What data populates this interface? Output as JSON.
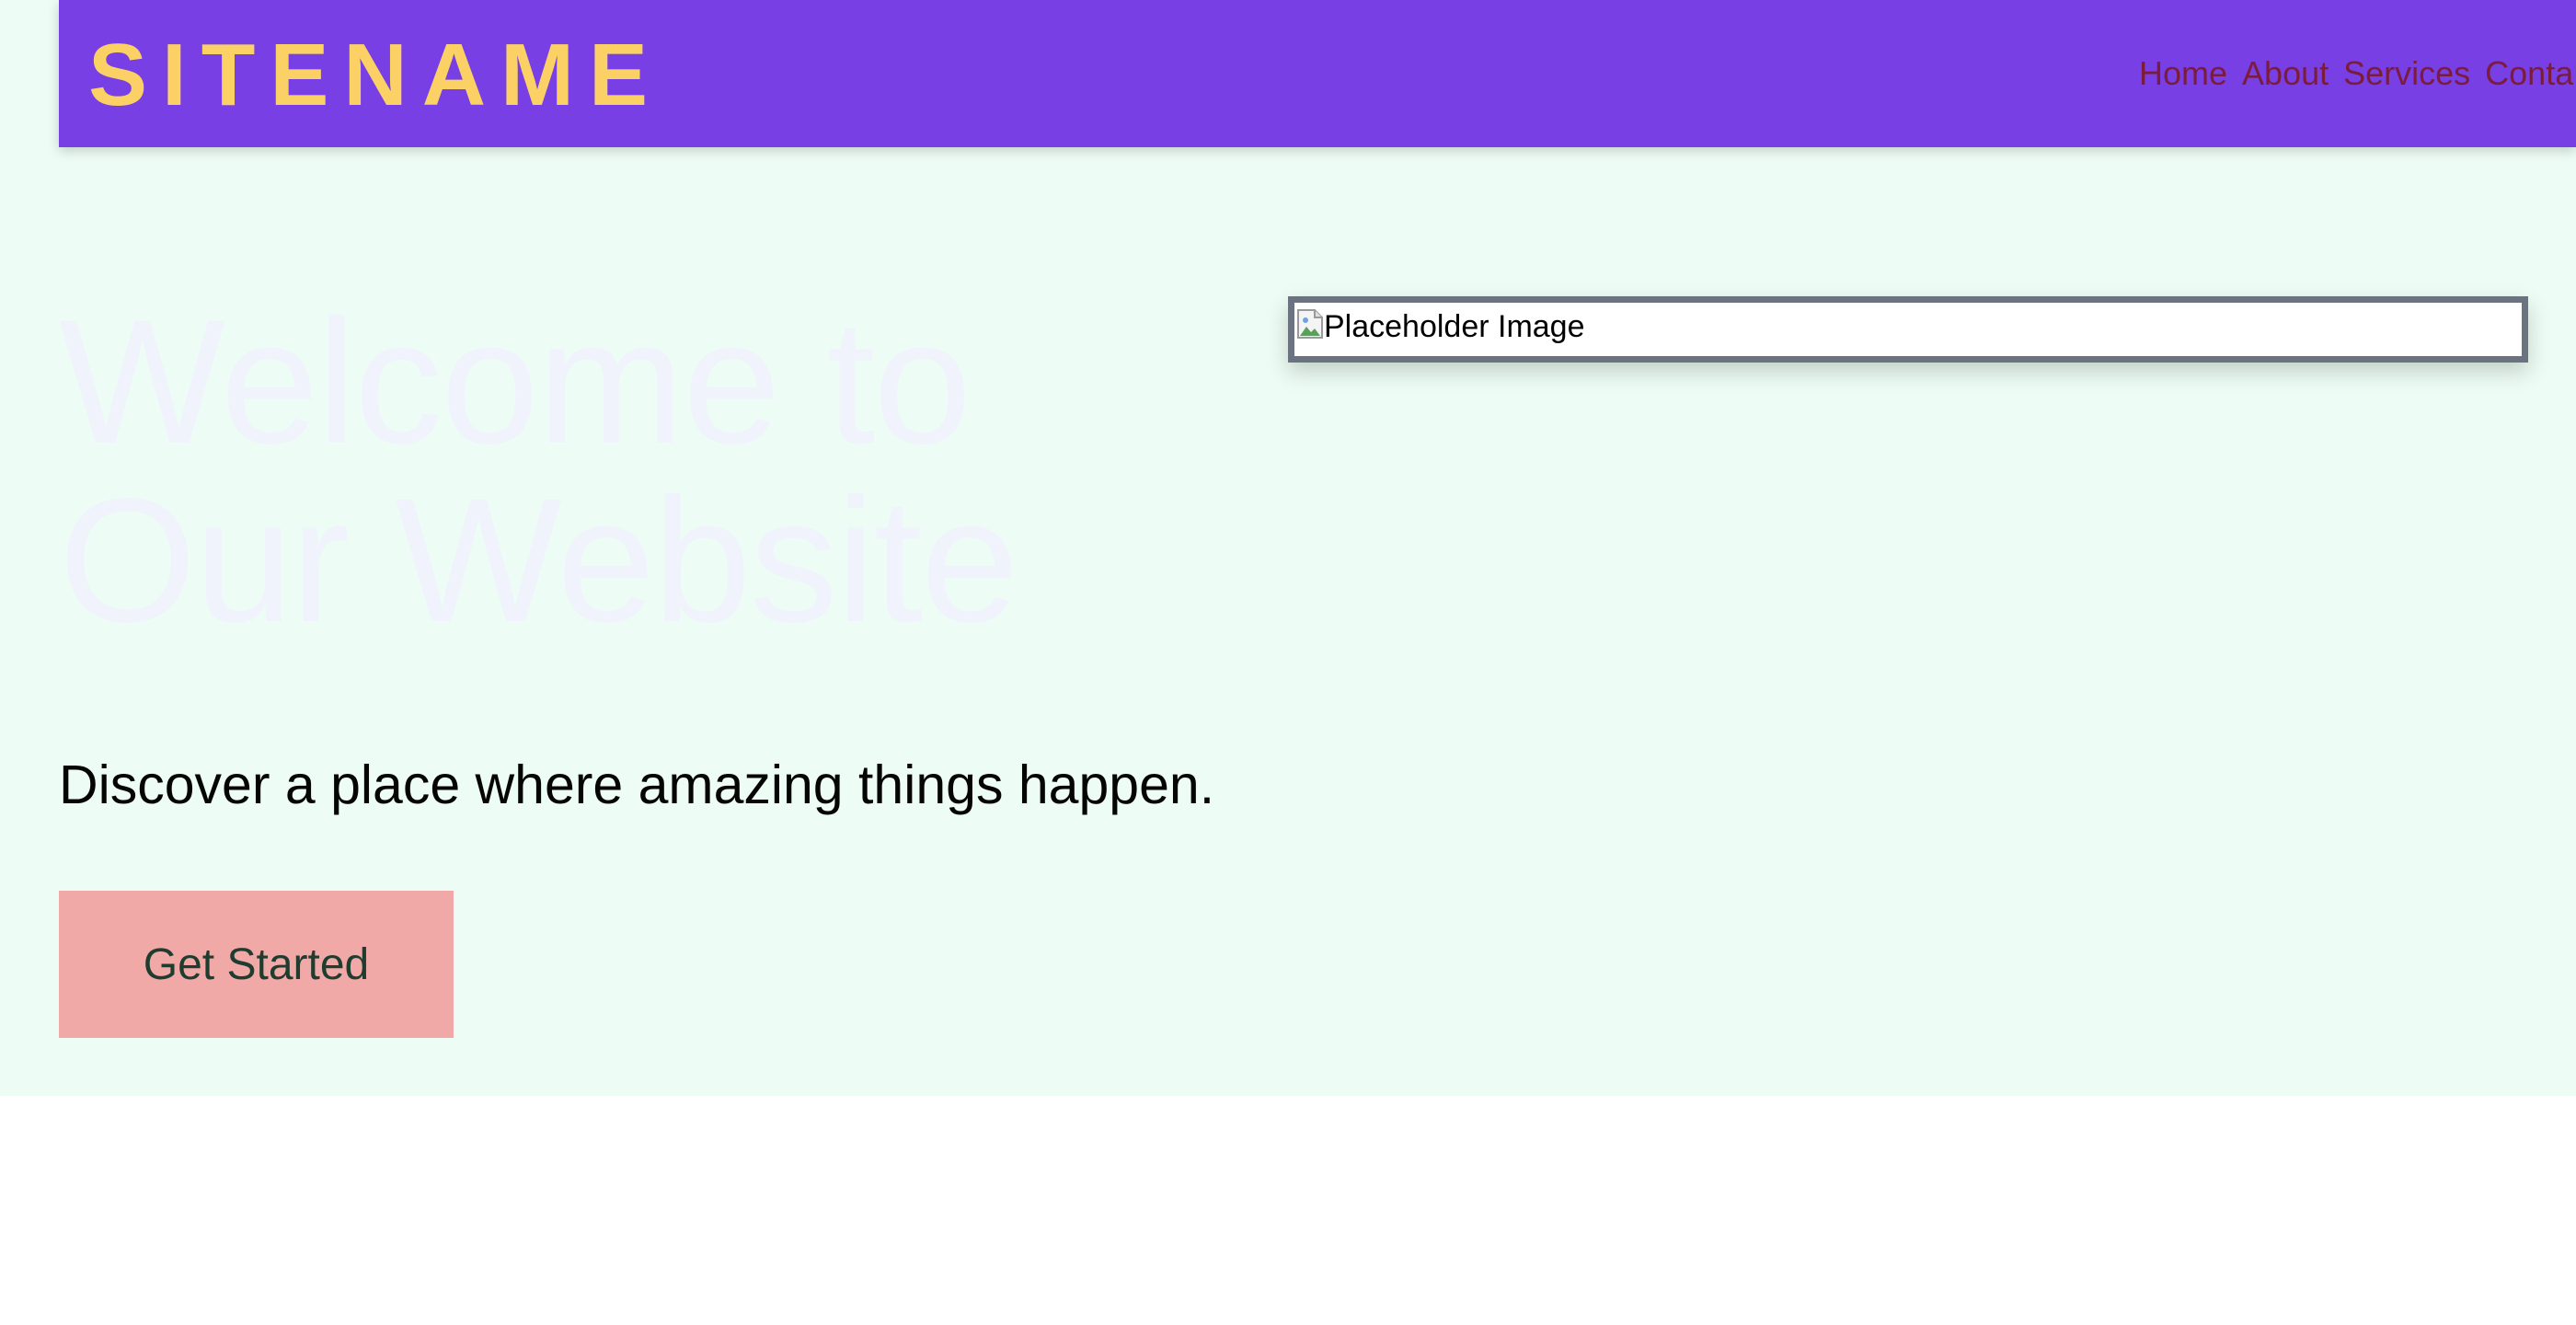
{
  "header": {
    "logo": "SITENAME",
    "nav": [
      "Home",
      "About",
      "Services",
      "Conta"
    ]
  },
  "hero": {
    "title": "Welcome to Our Website",
    "subtitle": "Discover a place where amazing things happen.",
    "cta_label": "Get Started",
    "image_alt": "Placeholder Image"
  },
  "icons": {
    "broken_image": "broken-image-icon"
  },
  "colors": {
    "header_bg": "#773fe4",
    "logo": "#fbd166",
    "nav_link": "#7b1c3d",
    "hero_bg": "#edfcf4",
    "cta_bg": "#f1a9a8",
    "cta_text": "#1f3d2f"
  }
}
